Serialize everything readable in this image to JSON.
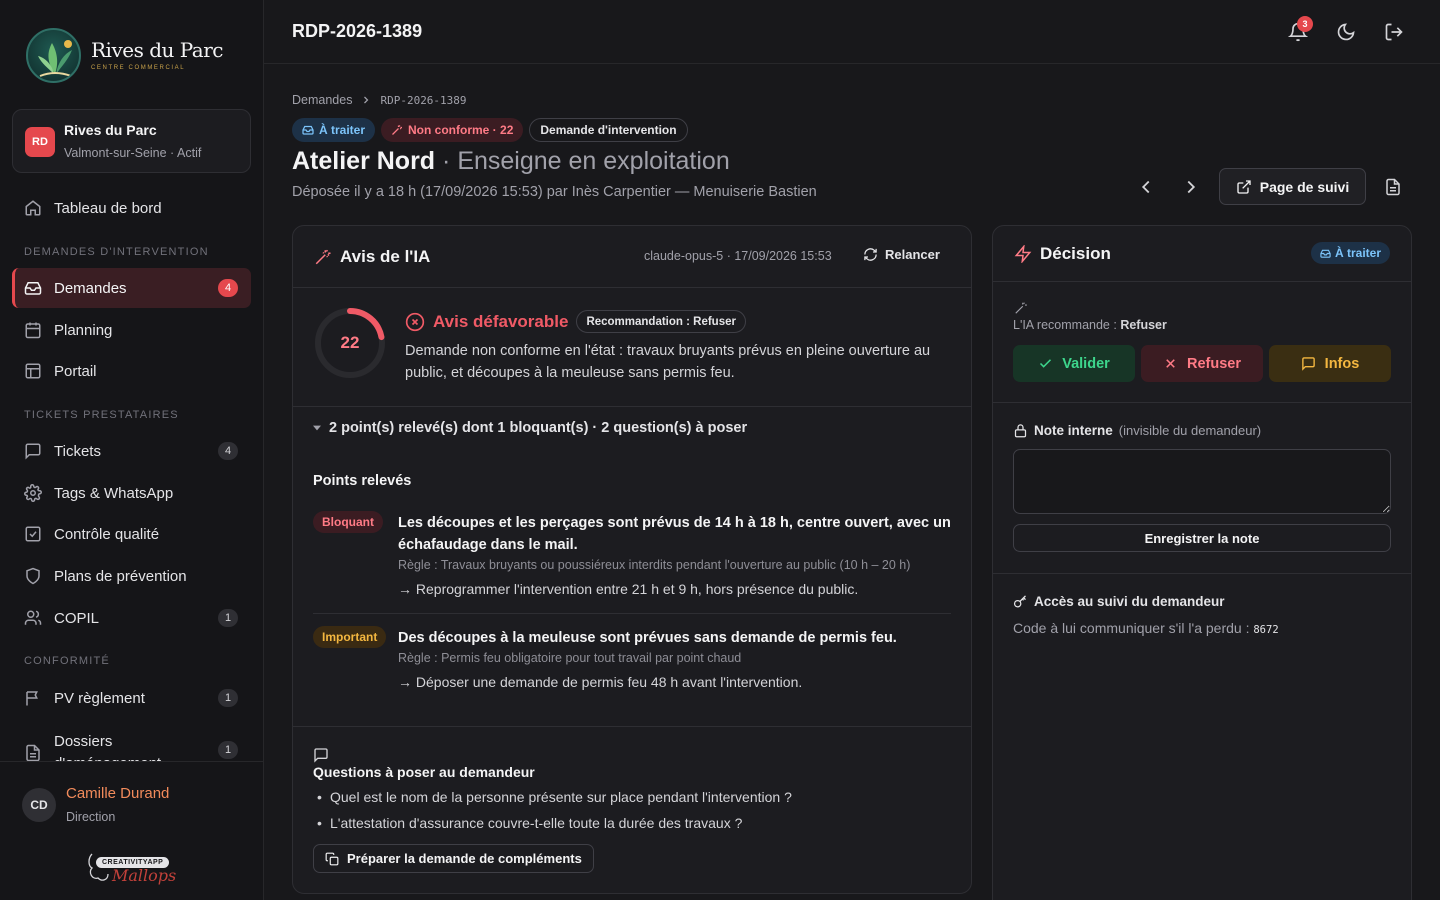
{
  "brand": {
    "name": "Rives du Parc",
    "tagline": "CENTRE COMMERCIAL"
  },
  "site": {
    "initials": "RD",
    "name": "Rives du Parc",
    "subtitle": "Valmont-sur-Seine · Actif"
  },
  "sidebar": {
    "dashboard": "Tableau de bord",
    "section_demandes": "DEMANDES D'INTERVENTION",
    "demandes": {
      "label": "Demandes",
      "badge": "4"
    },
    "planning": "Planning",
    "portail": "Portail",
    "section_tickets": "TICKETS PRESTATAIRES",
    "tickets": {
      "label": "Tickets",
      "badge": "4"
    },
    "tags": "Tags & WhatsApp",
    "controle": "Contrôle qualité",
    "plans": "Plans de prévention",
    "copil": {
      "label": "COPIL",
      "badge": "1"
    },
    "section_conformite": "CONFORMITÉ",
    "pv": {
      "label": "PV règlement",
      "badge": "1"
    },
    "dossiers": {
      "label": "Dossiers d'aménagement",
      "badge": "1"
    }
  },
  "user": {
    "initials": "CD",
    "name": "Camille Durand",
    "role": "Direction"
  },
  "credit": {
    "pill": "CREATIVITYAPP",
    "script": "Mallops"
  },
  "topbar": {
    "title": "RDP-2026-1389",
    "notifications": "3"
  },
  "breadcrumb": {
    "parent": "Demandes",
    "current": "RDP-2026-1389"
  },
  "chips": {
    "status": "À traiter",
    "conformity": "Non conforme · 22",
    "type": "Demande d'intervention"
  },
  "page": {
    "title": "Atelier Nord",
    "subtitle": "· Enseigne en exploitation",
    "meta": "Déposée il y a 18 h (17/09/2026 15:53) par Inès Carpentier — Menuiserie Bastien",
    "follow_button": "Page de suivi"
  },
  "ai": {
    "title": "Avis de l'IA",
    "meta": "claude-opus-5 · 17/09/2026 15:53",
    "relaunch": "Relancer",
    "score": 22,
    "verdict": "Avis défavorable",
    "recommendation": "Recommandation : Refuser",
    "summary_text": "Demande non conforme en l'état : travaux bruyants prévus en pleine ouverture au public, et découpes à la meuleuse sans permis feu.",
    "collapse_summary": "2 point(s) relevé(s) dont 1 bloquant(s) · 2 question(s) à poser",
    "points_title": "Points relevés",
    "points": [
      {
        "severity": "Bloquant",
        "title": "Les découpes et les perçages sont prévus de 14 h à 18 h, centre ouvert, avec un échafaudage dans le mail.",
        "rule": "Règle : Travaux bruyants ou poussiéreux interdits pendant l'ouverture au public (10 h – 20 h)",
        "action": "→ Reprogrammer l'intervention entre 21 h et 9 h, hors présence du public."
      },
      {
        "severity": "Important",
        "title": "Des découpes à la meuleuse sont prévues sans demande de permis feu.",
        "rule": "Règle : Permis feu obligatoire pour tout travail par point chaud",
        "action": "→ Déposer une demande de permis feu 48 h avant l'intervention."
      }
    ],
    "questions_title": "Questions à poser au demandeur",
    "questions": [
      "Quel est le nom de la personne présente sur place pendant l'intervention ?",
      "L'attestation d'assurance couvre-t-elle toute la durée des travaux ?"
    ],
    "prepare_button": "Préparer la demande de compléments"
  },
  "decision": {
    "title": "Décision",
    "status": "À traiter",
    "reco_prefix": "L'IA recommande : ",
    "reco_value": "Refuser",
    "validate": "Valider",
    "refuse": "Refuser",
    "info": "Infos",
    "note_label": "Note interne",
    "note_hint": "(invisible du demandeur)",
    "note_value": "",
    "save_note": "Enregistrer la note",
    "access_title": "Accès au suivi du demandeur",
    "access_text": "Code à lui communiquer s'il l'a perdu : ",
    "access_code": "8672"
  },
  "colors": {
    "accent_red": "#e5484d",
    "success": "#3dd68c",
    "warning": "#f4b740",
    "info": "#7cc4fa"
  }
}
